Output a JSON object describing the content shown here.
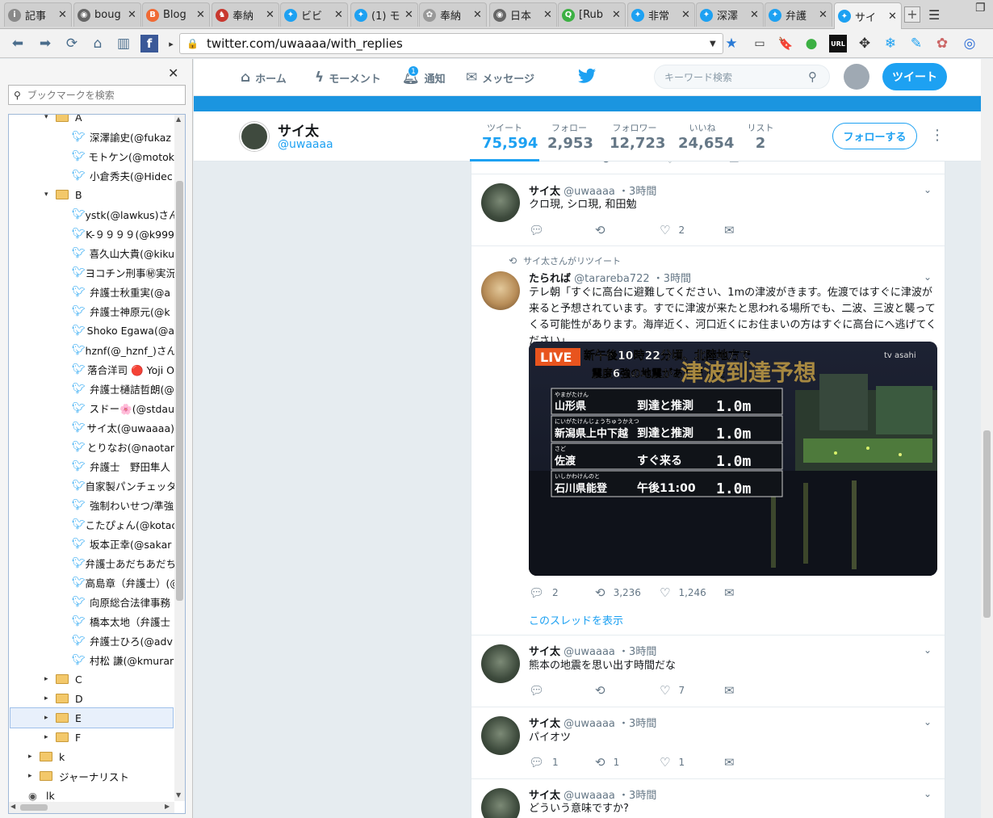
{
  "tabs": [
    {
      "title": "記事",
      "color": "#8a8a8a",
      "glyph": "i"
    },
    {
      "title": "boug",
      "color": "#666666",
      "glyph": "◉"
    },
    {
      "title": "Blog",
      "color": "#f06a35",
      "glyph": "B"
    },
    {
      "title": "奉納",
      "color": "#c8382f",
      "glyph": "♞"
    },
    {
      "title": "ビビ",
      "color": "#1da1f2",
      "glyph": "✦"
    },
    {
      "title": "(1) モ",
      "color": "#1da1f2",
      "glyph": "✦"
    },
    {
      "title": "奉納",
      "color": "#999999",
      "glyph": "✿"
    },
    {
      "title": "日本",
      "color": "#666666",
      "glyph": "◉"
    },
    {
      "title": "[Rub",
      "color": "#3cb043",
      "glyph": "Q"
    },
    {
      "title": "非常",
      "color": "#1da1f2",
      "glyph": "✦"
    },
    {
      "title": "深澤",
      "color": "#1da1f2",
      "glyph": "✦"
    },
    {
      "title": "弁護",
      "color": "#1da1f2",
      "glyph": "✦"
    },
    {
      "title": "サイ",
      "color": "#1da1f2",
      "glyph": "✦"
    }
  ],
  "browser": {
    "url": "twitter.com/uwaaaa/with_replies",
    "icons": [
      "back-icon",
      "forward-icon",
      "reload-icon",
      "home-icon"
    ]
  },
  "sidebar": {
    "search_placeholder": "ブックマークを検索",
    "tree": [
      {
        "kind": "folder",
        "label": "A",
        "open": true,
        "level": 1
      },
      {
        "kind": "item",
        "label": "深澤諭史(@fukaz",
        "level": 2
      },
      {
        "kind": "item",
        "label": "モトケン(@motok",
        "level": 2
      },
      {
        "kind": "item",
        "label": "小倉秀夫(@Hidec",
        "level": 2
      },
      {
        "kind": "folder",
        "label": "B",
        "open": true,
        "level": 1
      },
      {
        "kind": "item",
        "label": "ystk(@lawkus)さん",
        "level": 2
      },
      {
        "kind": "item",
        "label": "K-９９９９(@k999",
        "level": 2
      },
      {
        "kind": "item",
        "label": "喜久山大貴(@kiku",
        "level": 2
      },
      {
        "kind": "item",
        "label": "ヨコチン刑事㊙実況",
        "level": 2
      },
      {
        "kind": "item",
        "label": "弁護士秋重実(@a",
        "level": 2
      },
      {
        "kind": "item",
        "label": "弁護士神原元(@k",
        "level": 2
      },
      {
        "kind": "item",
        "label": "Shoko Egawa(@a",
        "level": 2
      },
      {
        "kind": "item",
        "label": "hznf(@_hznf_)さん",
        "level": 2
      },
      {
        "kind": "item",
        "label": "落合洋司 🔴 Yoji O",
        "level": 2
      },
      {
        "kind": "item",
        "label": "弁護士樋詰哲朗(@",
        "level": 2
      },
      {
        "kind": "item",
        "label": "スドー🌸(@stdau",
        "level": 2
      },
      {
        "kind": "item",
        "label": "サイ太(@uwaaaa)",
        "level": 2
      },
      {
        "kind": "item",
        "label": "とりなお(@naotar",
        "level": 2
      },
      {
        "kind": "item",
        "label": "弁護士　野田隼人",
        "level": 2
      },
      {
        "kind": "item",
        "label": "自家製パンチェッタ",
        "level": 2
      },
      {
        "kind": "item",
        "label": "強制わいせつ/準強",
        "level": 2
      },
      {
        "kind": "item",
        "label": "こたぴょん(@kotac",
        "level": 2
      },
      {
        "kind": "item",
        "label": "坂本正幸(@sakar",
        "level": 2
      },
      {
        "kind": "item",
        "label": "弁護士あだちあだち",
        "level": 2
      },
      {
        "kind": "item",
        "label": "高島章（弁護士）(@",
        "level": 2
      },
      {
        "kind": "item",
        "label": "向原総合法律事務",
        "level": 2
      },
      {
        "kind": "item",
        "label": "橋本太地（弁護士",
        "level": 2
      },
      {
        "kind": "item",
        "label": "弁護士ひろ(@adv",
        "level": 2
      },
      {
        "kind": "item",
        "label": "村松 謙(@kmurar",
        "level": 2
      },
      {
        "kind": "folder",
        "label": "C",
        "open": false,
        "level": 1
      },
      {
        "kind": "folder",
        "label": "D",
        "open": false,
        "level": 1
      },
      {
        "kind": "folder",
        "label": "E",
        "open": false,
        "level": 1,
        "selected": true
      },
      {
        "kind": "folder",
        "label": "F",
        "open": false,
        "level": 1
      },
      {
        "kind": "folder",
        "label": "k",
        "open": false,
        "level": 0
      },
      {
        "kind": "folder",
        "label": "ジャーナリスト",
        "open": false,
        "level": 0
      },
      {
        "kind": "link",
        "label": "lk",
        "level": 0
      }
    ]
  },
  "twitter_nav": {
    "home": "ホーム",
    "moments": "モーメント",
    "notifications": "通知",
    "notif_count": "1",
    "messages": "メッセージ",
    "search_placeholder": "キーワード検索",
    "tweet_button": "ツイート"
  },
  "profile": {
    "name": "サイ太",
    "handle": "@uwaaaa",
    "stats": [
      {
        "label": "ツイート",
        "value": "75,594"
      },
      {
        "label": "フォロー",
        "value": "2,953"
      },
      {
        "label": "フォロワー",
        "value": "12,723"
      },
      {
        "label": "いいね",
        "value": "24,654"
      },
      {
        "label": "リスト",
        "value": "2"
      }
    ],
    "follow_button": "フォローする"
  },
  "tweets": [
    {
      "name": "サイ太",
      "handle": "@uwaaaa",
      "time": "・3時間",
      "text": "クロ現, シロ現, 和田勉",
      "replies": "",
      "retweets": "",
      "likes": "2"
    },
    {
      "retweeted_by": "サイ太さんがリツイート",
      "name": "たられば",
      "handle": "@tarareba722",
      "time": "・3時間",
      "text": "テレ朝「すぐに高台に避難してください、1mの津波がきます。佐渡ではすぐに津波が来ると予想されています。すでに津波が来たと思われる場所でも、二波、三波と襲ってくる可能性があります。海岸近く、河口近くにお住まいの方はすぐに高台にへ逃げてください」",
      "replies": "2",
      "retweets": "3,236",
      "likes": "1,246",
      "thread_link": "このスレッドを表示",
      "media": {
        "live": "LIVE",
        "channel": "tv asahi",
        "headline": "新午後10時22分頃、北陸地方で",
        "subline": "震度6強の地震がありました",
        "overlay_title": "津波到達予想",
        "rows": [
          {
            "ruby": "やまがたけん",
            "place": "山形県",
            "status": "到達と推測",
            "height": "1.0m"
          },
          {
            "ruby": "にいがたけんじょうちゅうかえつ",
            "place": "新潟県上中下越",
            "status": "到達と推測",
            "height": "1.0m"
          },
          {
            "ruby": "さど",
            "place": "佐渡",
            "status": "すぐ来る",
            "height": "1.0m"
          },
          {
            "ruby": "いしかわけんのと",
            "place": "石川県能登",
            "status": "午後11:00",
            "height": "1.0m"
          }
        ]
      }
    },
    {
      "name": "サイ太",
      "handle": "@uwaaaa",
      "time": "・3時間",
      "text": "熊本の地震を思い出す時間だな",
      "replies": "",
      "retweets": "",
      "likes": "7"
    },
    {
      "name": "サイ太",
      "handle": "@uwaaaa",
      "time": "・3時間",
      "text": "パイオツ",
      "replies": "1",
      "retweets": "1",
      "likes": "1"
    },
    {
      "name": "サイ太",
      "handle": "@uwaaaa",
      "time": "・3時間",
      "text": "どういう意味ですか?"
    }
  ]
}
